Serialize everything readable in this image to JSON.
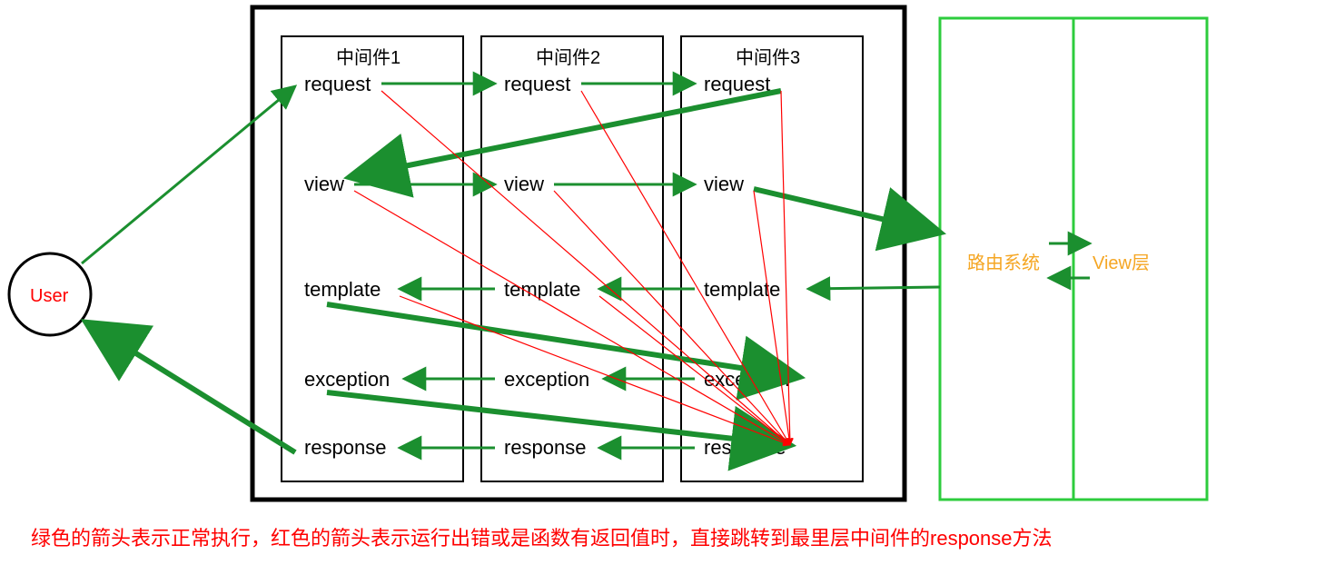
{
  "user_label": "User",
  "middleware": [
    {
      "title": "中间件1",
      "rows": [
        "request",
        "view",
        "template",
        "exception",
        "response"
      ]
    },
    {
      "title": "中间件2",
      "rows": [
        "request",
        "view",
        "template",
        "exception",
        "response"
      ]
    },
    {
      "title": "中间件3",
      "rows": [
        "request",
        "view",
        "template",
        "exception",
        "response"
      ]
    }
  ],
  "routing_label": "路由系统",
  "view_layer_label": "View层",
  "caption": "绿色的箭头表示正常执行，红色的箭头表示运行出错或是函数有返回值时，直接跳转到最里层中间件的response方法",
  "colors": {
    "green": "#1b8f2f",
    "bright_green": "#2dcc3d",
    "red": "#ff0000",
    "orange": "#f5a623",
    "black": "#000000"
  }
}
